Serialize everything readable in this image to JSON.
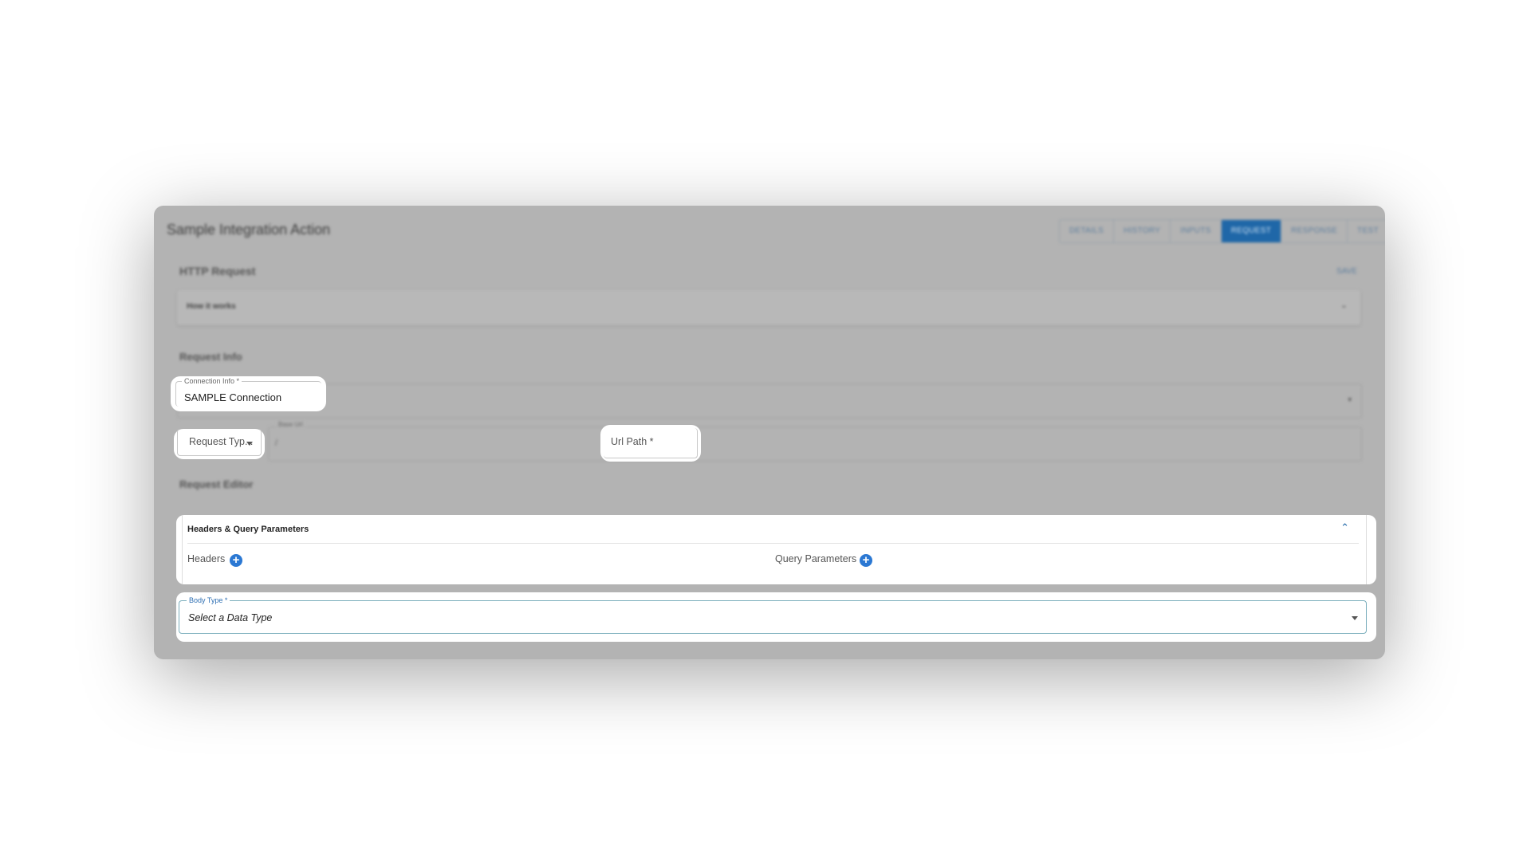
{
  "app": {
    "title": "Sample Integration Action"
  },
  "tabs": [
    {
      "label": "DETAILS",
      "active": false
    },
    {
      "label": "HISTORY",
      "active": false
    },
    {
      "label": "INPUTS",
      "active": false
    },
    {
      "label": "REQUEST",
      "active": true
    },
    {
      "label": "RESPONSE",
      "active": false
    },
    {
      "label": "TEST",
      "active": false
    }
  ],
  "http_request": {
    "title": "HTTP Request",
    "save_label": "SAVE",
    "how_it_works_label": "How it works"
  },
  "request_info": {
    "title": "Request Info",
    "connection_field": {
      "label": "Connection Info *",
      "value": "SAMPLE Connection"
    },
    "request_type_field": {
      "placeholder": "Request Typ..."
    },
    "base_url_field": {
      "label": "Base Url",
      "value": "/"
    },
    "url_path_field": {
      "placeholder": "Url Path *"
    }
  },
  "request_editor": {
    "title": "Request Editor",
    "params_section": {
      "title": "Headers & Query Parameters",
      "headers_label": "Headers",
      "query_label": "Query Parameters"
    },
    "body_type_field": {
      "label": "Body Type *",
      "value": "Select a Data Type"
    }
  },
  "colors": {
    "accent": "#2b78d3",
    "active_tab": "#1f67a8",
    "overlay": "#b3b3b3"
  },
  "icons": {
    "add": "plus-circle-icon",
    "expand": "chevron-down-icon",
    "collapse": "chevron-up-icon",
    "dropdown": "caret-down-icon"
  }
}
